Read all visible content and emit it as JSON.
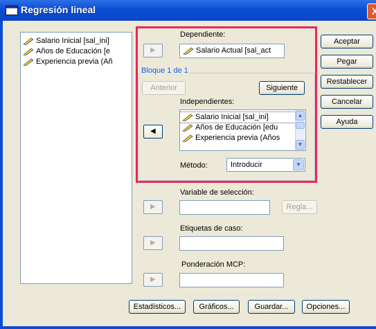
{
  "window": {
    "title": "Regresión lineal",
    "close_label": "X"
  },
  "variables": [
    "Salario Inicial [sal_ini]",
    "Años de Educación [e",
    "Experiencia previa (Añ"
  ],
  "dependent": {
    "label": "Dependiente:",
    "value": "Salario Actual [sal_act"
  },
  "block": {
    "title": "Bloque 1 de 1",
    "prev_label": "Anterior",
    "next_label": "Siguiente"
  },
  "independents": {
    "label": "Independientes:",
    "items": [
      "Salario Inicial [sal_ini]",
      "Años de Educación [edu",
      "Experiencia previa (Años"
    ]
  },
  "method": {
    "label": "Método:",
    "value": "Introducir"
  },
  "selection": {
    "label": "Variable de selección:",
    "rule_label": "Regla..."
  },
  "case_labels": {
    "label": "Etiquetas de caso:"
  },
  "wls": {
    "label": "Ponderación MCP:"
  },
  "right_buttons": {
    "accept": "Aceptar",
    "paste": "Pegar",
    "reset": "Restablecer",
    "cancel": "Cancelar",
    "help": "Ayuda"
  },
  "bottom_buttons": {
    "statistics": "Estadísticos...",
    "plots": "Gráficos...",
    "save": "Guardar...",
    "options": "Opciones..."
  },
  "icons": {
    "ruler": "ruler-icon",
    "arrow_right": "arrow-right-icon",
    "arrow_left": "arrow-left-icon",
    "scroll_up": "scroll-up-icon",
    "scroll_down": "scroll-down-icon",
    "dropdown": "chevron-down-icon"
  },
  "colors": {
    "highlight": "#e8285a",
    "titlebar": "#0b4ed3",
    "group_title": "#1d5be0"
  }
}
